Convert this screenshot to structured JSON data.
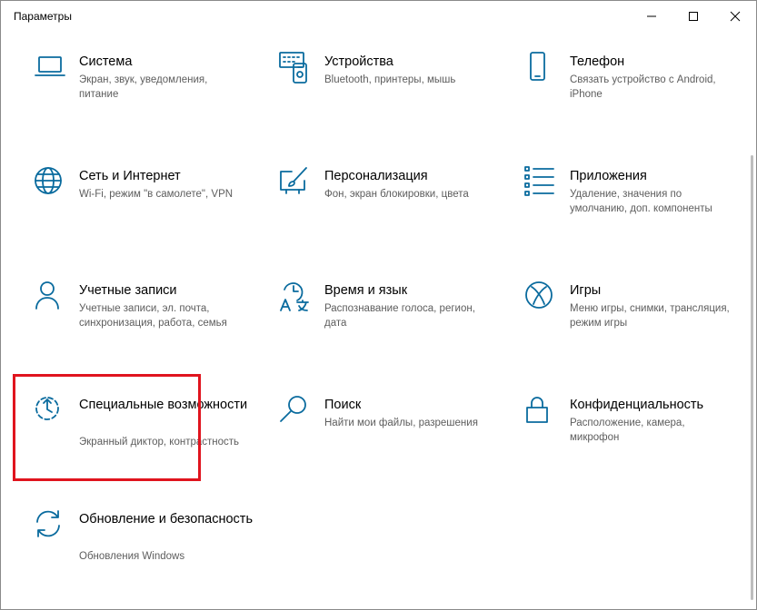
{
  "window": {
    "title": "Параметры"
  },
  "colors": {
    "accent": "#0a6b9e",
    "highlight": "#e0141e",
    "description": "#5d5d5d"
  },
  "tiles": [
    {
      "name": "Система",
      "desc": "Экран, звук, уведомления, питание",
      "icon": "laptop-icon"
    },
    {
      "name": "Устройства",
      "desc": "Bluetooth, принтеры, мышь",
      "icon": "keyboard-devices-icon"
    },
    {
      "name": "Телефон",
      "desc": "Связать устройство с Android, iPhone",
      "icon": "phone-icon"
    },
    {
      "name": "Сеть и Интернет",
      "desc": "Wi-Fi, режим \"в самолете\", VPN",
      "icon": "globe-icon"
    },
    {
      "name": "Персонализация",
      "desc": "Фон, экран блокировки, цвета",
      "icon": "paint-brush-icon"
    },
    {
      "name": "Приложения",
      "desc": "Удаление, значения по умолчанию, доп. компоненты",
      "icon": "apps-list-icon"
    },
    {
      "name": "Учетные записи",
      "desc": "Учетные записи, эл. почта, синхронизация, работа, семья",
      "icon": "person-icon"
    },
    {
      "name": "Время и язык",
      "desc": "Распознавание голоса, регион, дата",
      "icon": "time-language-icon"
    },
    {
      "name": "Игры",
      "desc": "Меню игры, снимки, трансляция, режим игры",
      "icon": "xbox-icon"
    },
    {
      "name": "Специальные возможности",
      "desc": "Экранный диктор, контрастность",
      "icon": "ease-of-access-icon"
    },
    {
      "name": "Поиск",
      "desc": "Найти мои файлы, разрешения",
      "icon": "search-icon"
    },
    {
      "name": "Конфиденциальность",
      "desc": "Расположение, камера, микрофон",
      "icon": "lock-icon"
    },
    {
      "name": "Обновление и безопасность",
      "desc": "Обновления Windows",
      "icon": "update-icon"
    }
  ]
}
